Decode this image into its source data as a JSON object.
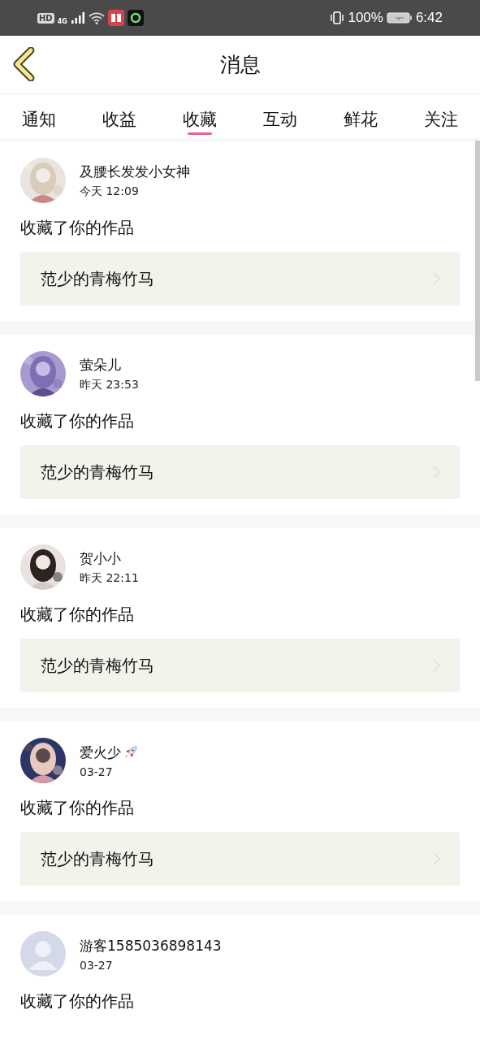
{
  "status_bar": {
    "hd": "HD",
    "network": "4G",
    "battery": "100%",
    "time": "6:42"
  },
  "header": {
    "title": "消息"
  },
  "tabs": [
    {
      "label": "通知",
      "selected": false
    },
    {
      "label": "收益",
      "selected": false
    },
    {
      "label": "收藏",
      "selected": true
    },
    {
      "label": "互动",
      "selected": false
    },
    {
      "label": "鲜花",
      "selected": false
    },
    {
      "label": "关注",
      "selected": false
    }
  ],
  "messages": [
    {
      "user": "及腰长发发小女神",
      "rocket": false,
      "time": "今天 12:09",
      "action": "收藏了你的作品",
      "work": "范少的青梅竹马"
    },
    {
      "user": "萤朵儿",
      "rocket": false,
      "time": "昨天 23:53",
      "action": "收藏了你的作品",
      "work": "范少的青梅竹马"
    },
    {
      "user": "贺小小",
      "rocket": false,
      "time": "昨天 22:11",
      "action": "收藏了你的作品",
      "work": "范少的青梅竹马"
    },
    {
      "user": "爱火少",
      "rocket": true,
      "time": "03-27",
      "action": "收藏了你的作品",
      "work": "范少的青梅竹马"
    },
    {
      "user": "游客1585036898143",
      "rocket": false,
      "time": "03-27",
      "avatar": {
        "kind": "default"
      },
      "action": "收藏了你的作品"
    }
  ]
}
